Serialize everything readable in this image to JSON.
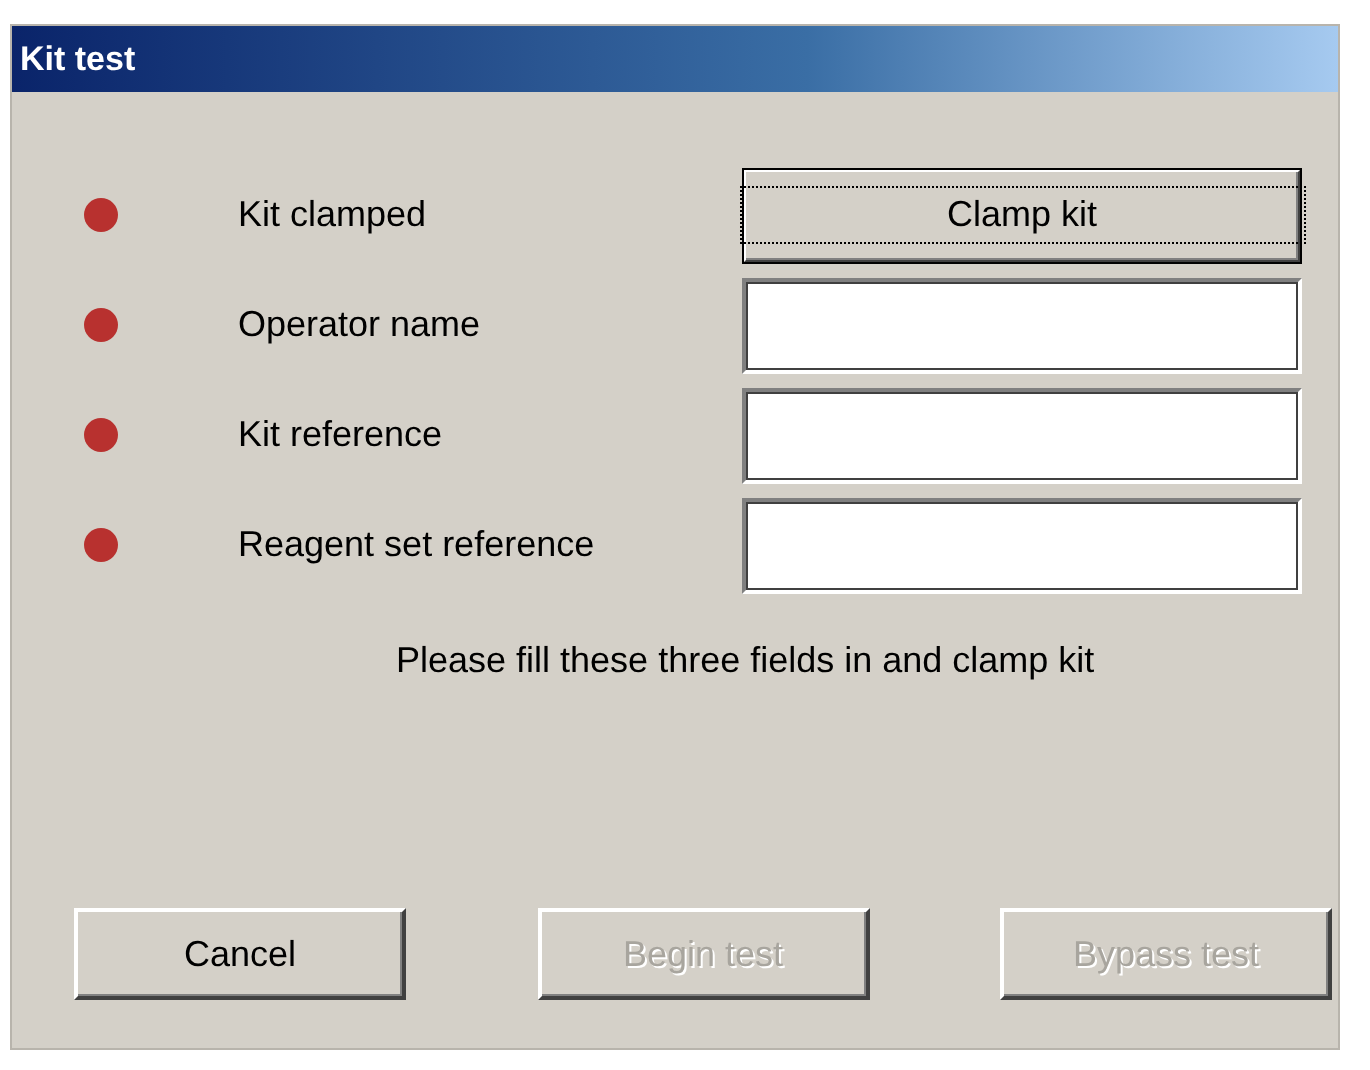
{
  "window": {
    "title": "Kit test"
  },
  "rows": [
    {
      "kind": "button",
      "label": "Kit clamped",
      "color": "#b8312f",
      "button": "Clamp kit",
      "focused": true
    },
    {
      "kind": "field",
      "label": "Operator name",
      "color": "#b8312f"
    },
    {
      "kind": "field",
      "label": "Kit reference",
      "color": "#b8312f"
    },
    {
      "kind": "field",
      "label": "Reagent set reference",
      "color": "#b8312f"
    }
  ],
  "message": "Please fill these three fields in and clamp kit",
  "buttons": [
    {
      "label": "Cancel",
      "disabled": false
    },
    {
      "label": "Begin test",
      "disabled": true
    },
    {
      "label": "Bypass test",
      "disabled": true
    }
  ]
}
